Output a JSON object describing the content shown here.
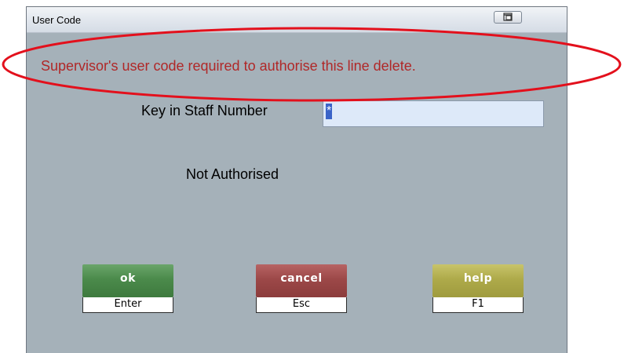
{
  "window": {
    "title": "User Code",
    "restore_icon": "restore-window-icon"
  },
  "dialog": {
    "message": "Supervisor's user code required to authorise this line delete.",
    "staff_label": "Key in Staff Number",
    "staff_value": "*",
    "status": "Not Authorised"
  },
  "buttons": {
    "ok": {
      "label": "ok",
      "key": "Enter",
      "color": "#4b8a4b"
    },
    "cancel": {
      "label": "cancel",
      "key": "Esc",
      "color": "#9c4848"
    },
    "help": {
      "label": "help",
      "key": "F1",
      "color": "#aeaa4a"
    }
  },
  "colors": {
    "window_bg": "#a5b1b9",
    "message_text": "#b02828",
    "annotation": "#e3101c",
    "input_bg": "#dde9f9"
  }
}
